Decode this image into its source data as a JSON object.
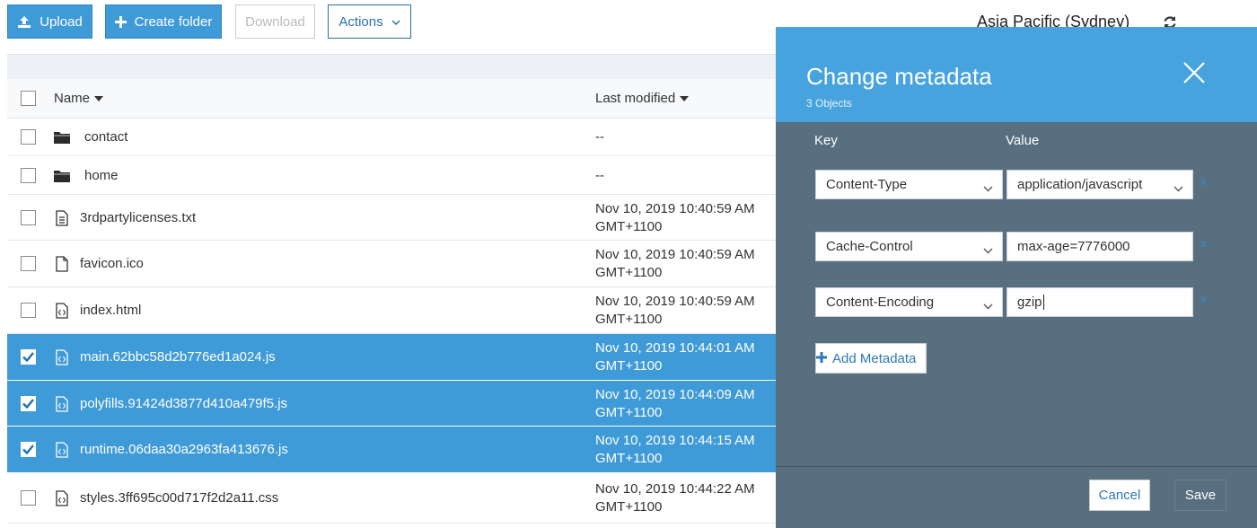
{
  "toolbar": {
    "upload_label": "Upload",
    "create_folder_label": "Create folder",
    "download_label": "Download",
    "actions_label": "Actions",
    "region": "Asia Pacific (Sydney)"
  },
  "table": {
    "col_name": "Name",
    "col_modified": "Last modified",
    "rows": [
      {
        "name": "contact",
        "icon": "folder-icon",
        "modified1": "--",
        "modified2": "",
        "selected": false
      },
      {
        "name": "home",
        "icon": "folder-icon",
        "modified1": "--",
        "modified2": "",
        "selected": false
      },
      {
        "name": "3rdpartylicenses.txt",
        "icon": "text-file-icon",
        "modified1": "Nov 10, 2019 10:40:59 AM",
        "modified2": "GMT+1100",
        "selected": false
      },
      {
        "name": "favicon.ico",
        "icon": "file-icon",
        "modified1": "Nov 10, 2019 10:40:59 AM",
        "modified2": "GMT+1100",
        "selected": false
      },
      {
        "name": "index.html",
        "icon": "code-file-icon",
        "modified1": "Nov 10, 2019 10:40:59 AM",
        "modified2": "GMT+1100",
        "selected": false
      },
      {
        "name": "main.62bbc58d2b776ed1a024.js",
        "icon": "code-file-icon",
        "modified1": "Nov 10, 2019 10:44:01 AM",
        "modified2": "GMT+1100",
        "selected": true
      },
      {
        "name": "polyfills.91424d3877d410a479f5.js",
        "icon": "code-file-icon",
        "modified1": "Nov 10, 2019 10:44:09 AM",
        "modified2": "GMT+1100",
        "selected": true
      },
      {
        "name": "runtime.06daa30a2963fa413676.js",
        "icon": "code-file-icon",
        "modified1": "Nov 10, 2019 10:44:15 AM",
        "modified2": "GMT+1100",
        "selected": true
      },
      {
        "name": "styles.3ff695c00d717f2d2a11.css",
        "icon": "code-file-icon",
        "modified1": "Nov 10, 2019 10:44:22 AM",
        "modified2": "GMT+1100",
        "selected": false
      }
    ]
  },
  "panel": {
    "title": "Change metadata",
    "subtitle": "3 Objects",
    "key_label": "Key",
    "value_label": "Value",
    "entries": [
      {
        "key": "Content-Type",
        "value": "application/javascript"
      },
      {
        "key": "Cache-Control",
        "value": "max-age=7776000"
      },
      {
        "key": "Content-Encoding",
        "value": "gzip"
      }
    ],
    "delete_glyph": "x",
    "add_label": "Add Metadata",
    "cancel_label": "Cancel",
    "save_label": "Save"
  },
  "colors": {
    "primary": "#3f9ad8",
    "panel_header": "#47a3dd",
    "panel_body": "#586f7f",
    "selected_row": "#3f9ad8"
  }
}
